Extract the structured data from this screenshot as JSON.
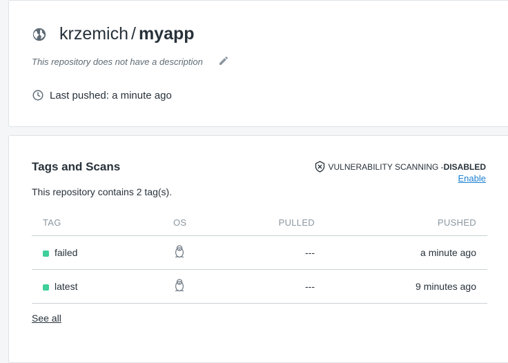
{
  "repo": {
    "owner": "krzemich",
    "separator": "/",
    "name": "myapp",
    "description": "This repository does not have a description",
    "last_pushed": "Last pushed: a minute ago",
    "icons": {
      "visibility": "globe-icon",
      "edit": "pencil-icon",
      "time": "clock-icon"
    }
  },
  "tags": {
    "title": "Tags and Scans",
    "summary": "This repository contains 2 tag(s).",
    "vulnerability": {
      "label": "VULNERABILITY SCANNING - ",
      "state": "DISABLED",
      "action": "Enable"
    },
    "columns": {
      "tag": "TAG",
      "os": "OS",
      "pulled": "PULLED",
      "pushed": "PUSHED"
    },
    "rows": [
      {
        "name": "failed",
        "os_icon": "linux-icon",
        "pulled": "---",
        "pushed": "a minute ago"
      },
      {
        "name": "latest",
        "os_icon": "linux-icon",
        "pulled": "---",
        "pushed": "9 minutes ago"
      }
    ],
    "see_all": "See all",
    "status_color": "#3ecf9a",
    "link_color": "#1a7fd0"
  }
}
